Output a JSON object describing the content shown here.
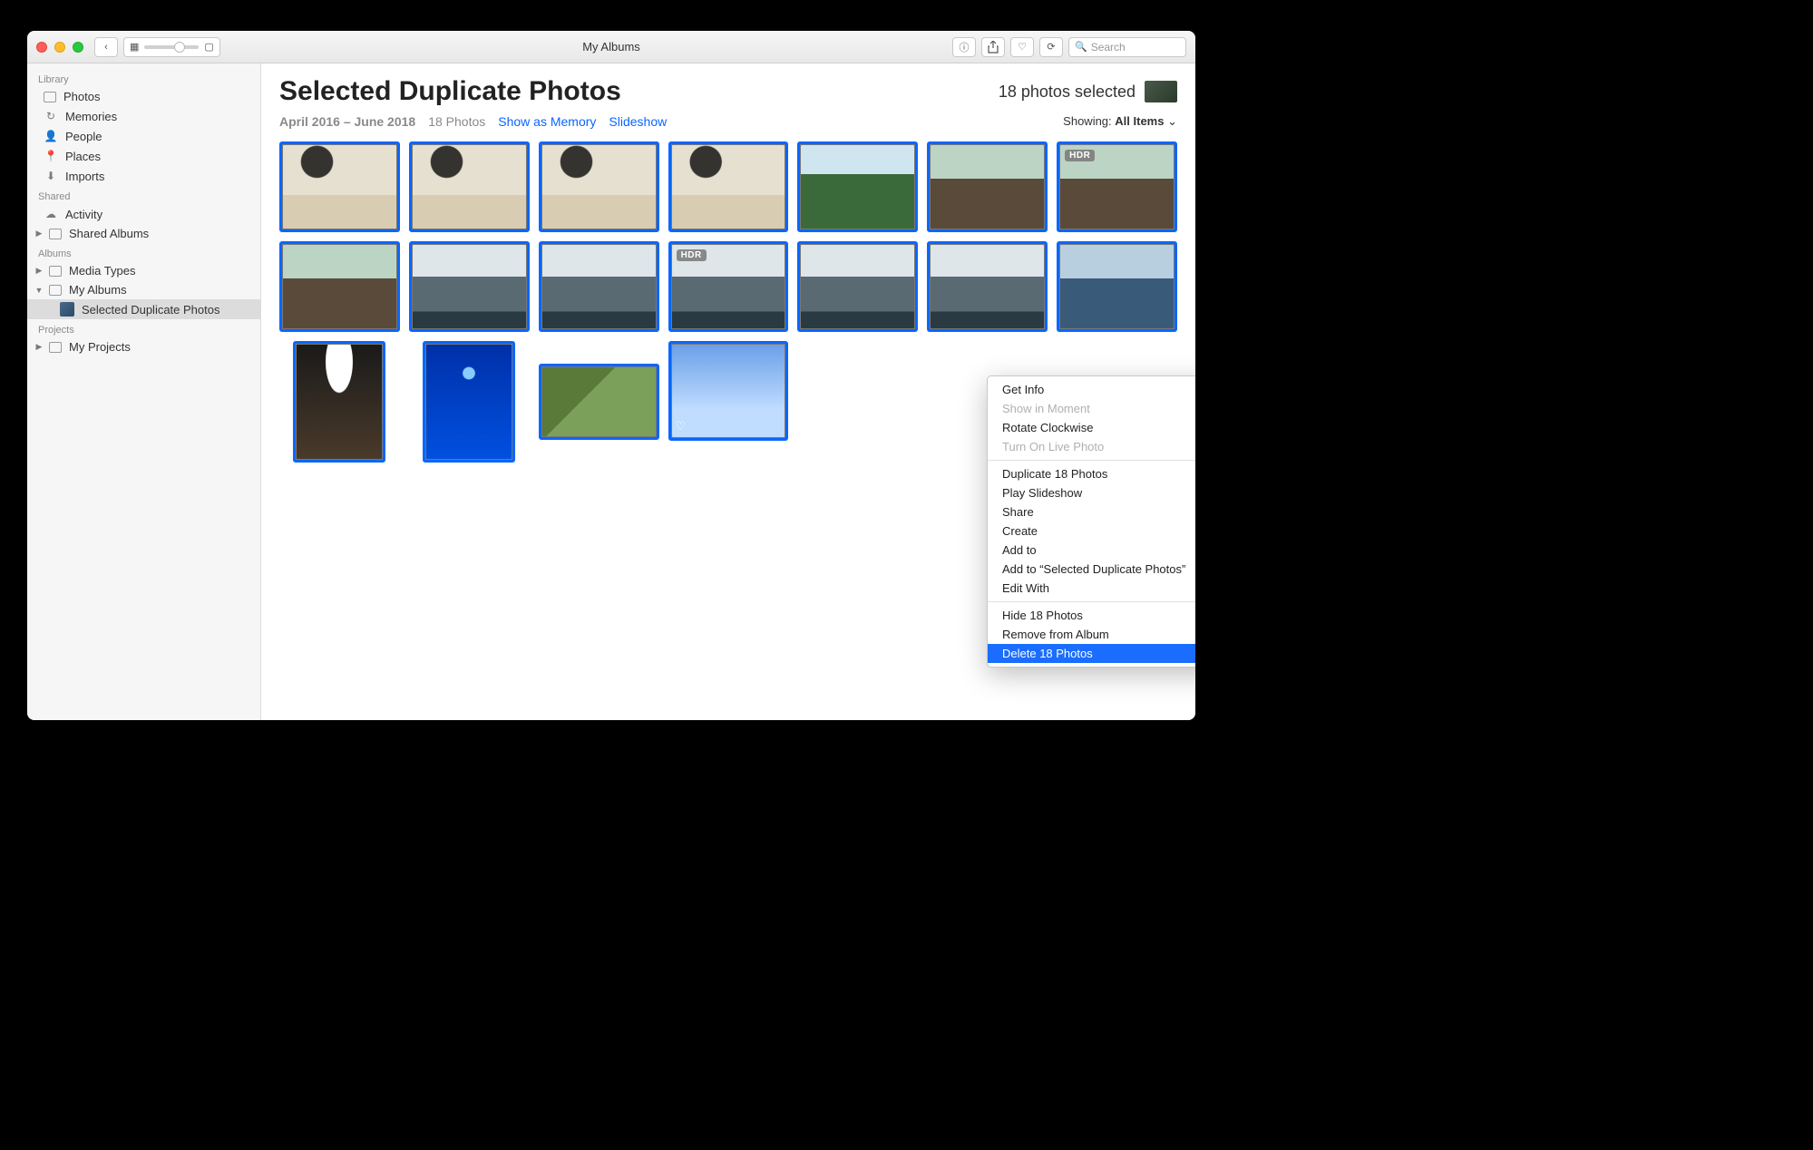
{
  "titlebar": {
    "title": "My Albums",
    "search_placeholder": "Search"
  },
  "sidebar": {
    "sections": [
      {
        "label": "Library",
        "items": [
          {
            "label": "Photos"
          },
          {
            "label": "Memories"
          },
          {
            "label": "People"
          },
          {
            "label": "Places"
          },
          {
            "label": "Imports"
          }
        ]
      },
      {
        "label": "Shared",
        "items": [
          {
            "label": "Activity"
          },
          {
            "label": "Shared Albums"
          }
        ]
      },
      {
        "label": "Albums",
        "items": [
          {
            "label": "Media Types"
          },
          {
            "label": "My Albums"
          },
          {
            "label": "Selected Duplicate Photos"
          }
        ]
      },
      {
        "label": "Projects",
        "items": [
          {
            "label": "My Projects"
          }
        ]
      }
    ]
  },
  "header": {
    "album_title": "Selected Duplicate Photos",
    "selection_text": "18 photos selected",
    "date_range": "April 2016 – June 2018",
    "count_text": "18 Photos",
    "show_as_memory": "Show as Memory",
    "slideshow": "Slideshow",
    "showing_label": "Showing:",
    "showing_value": "All Items"
  },
  "badges": {
    "hdr": "HDR"
  },
  "context_menu": {
    "items": [
      {
        "label": "Get Info",
        "disabled": false
      },
      {
        "label": "Show in Moment",
        "disabled": true
      },
      {
        "label": "Rotate Clockwise",
        "disabled": false
      },
      {
        "label": "Turn On Live Photo",
        "disabled": true
      },
      {
        "sep": true
      },
      {
        "label": "Duplicate 18 Photos"
      },
      {
        "label": "Play Slideshow"
      },
      {
        "label": "Share",
        "submenu": true
      },
      {
        "label": "Create",
        "submenu": true
      },
      {
        "label": "Add to",
        "submenu": true
      },
      {
        "label": "Add to “Selected Duplicate Photos”"
      },
      {
        "label": "Edit With",
        "submenu": true
      },
      {
        "sep": true
      },
      {
        "label": "Hide 18 Photos"
      },
      {
        "label": "Remove from Album"
      },
      {
        "label": "Delete 18 Photos",
        "highlight": true
      }
    ]
  }
}
